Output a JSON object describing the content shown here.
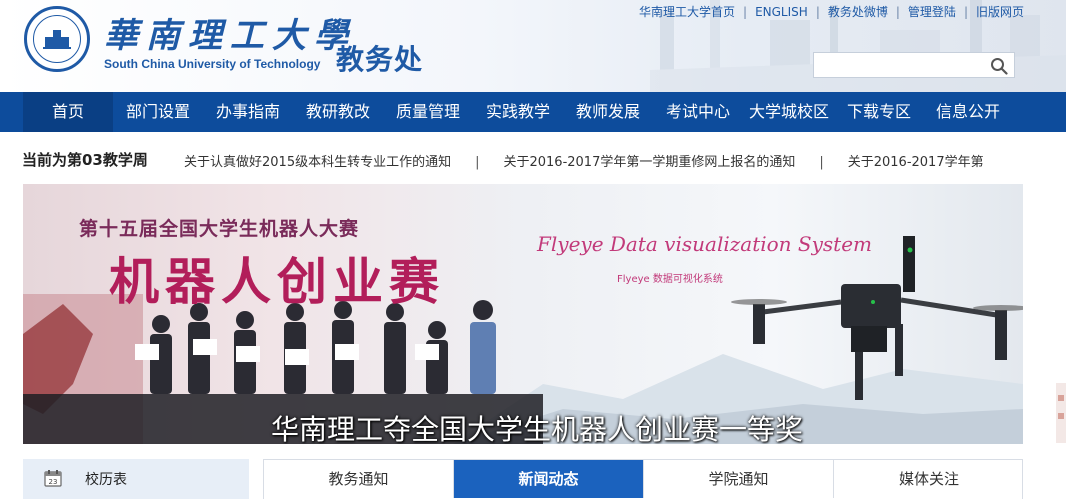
{
  "header": {
    "logo_cn": "華南理工大學",
    "logo_en": "South China University of Technology",
    "site_title": "教务处",
    "top_links": [
      {
        "label": "华南理工大学首页"
      },
      {
        "label": "ENGLISH"
      },
      {
        "label": "教务处微博"
      },
      {
        "label": "管理登陆"
      },
      {
        "label": "旧版网页"
      }
    ],
    "search": {
      "value": "",
      "placeholder": ""
    }
  },
  "nav": {
    "items": [
      {
        "label": "首页"
      },
      {
        "label": "部门设置"
      },
      {
        "label": "办事指南"
      },
      {
        "label": "教研教改"
      },
      {
        "label": "质量管理"
      },
      {
        "label": "实践教学"
      },
      {
        "label": "教师发展"
      },
      {
        "label": "考试中心"
      },
      {
        "label": "大学城校区"
      },
      {
        "label": "下载专区"
      },
      {
        "label": "信息公开"
      }
    ]
  },
  "notice": {
    "week": "当前为第03教学周",
    "items": [
      "关于认真做好2015级本科生转专业工作的通知",
      "关于2016-2017学年第一学期重修网上报名的通知",
      "关于2016-2017学年第"
    ],
    "separator": "|"
  },
  "banner": {
    "contest_title": "第十五届全国大学生机器人大赛",
    "big_text": "机器人创业赛",
    "flyeye_title": "Flyeye Data visualization System",
    "flyeye_sub": "Flyeye 数据可视化系统",
    "caption": "华南理工夺全国大学生机器人创业赛一等奖"
  },
  "calendar": {
    "label": "校历表",
    "icon": "calendar-icon"
  },
  "tabs": [
    {
      "label": "教务通知"
    },
    {
      "label": "新闻动态"
    },
    {
      "label": "学院通知"
    },
    {
      "label": "媒体关注"
    }
  ],
  "colors": {
    "primary": "#0d4c9c",
    "accent_tab": "#1b62be",
    "brand_text": "#1f5aa6"
  }
}
